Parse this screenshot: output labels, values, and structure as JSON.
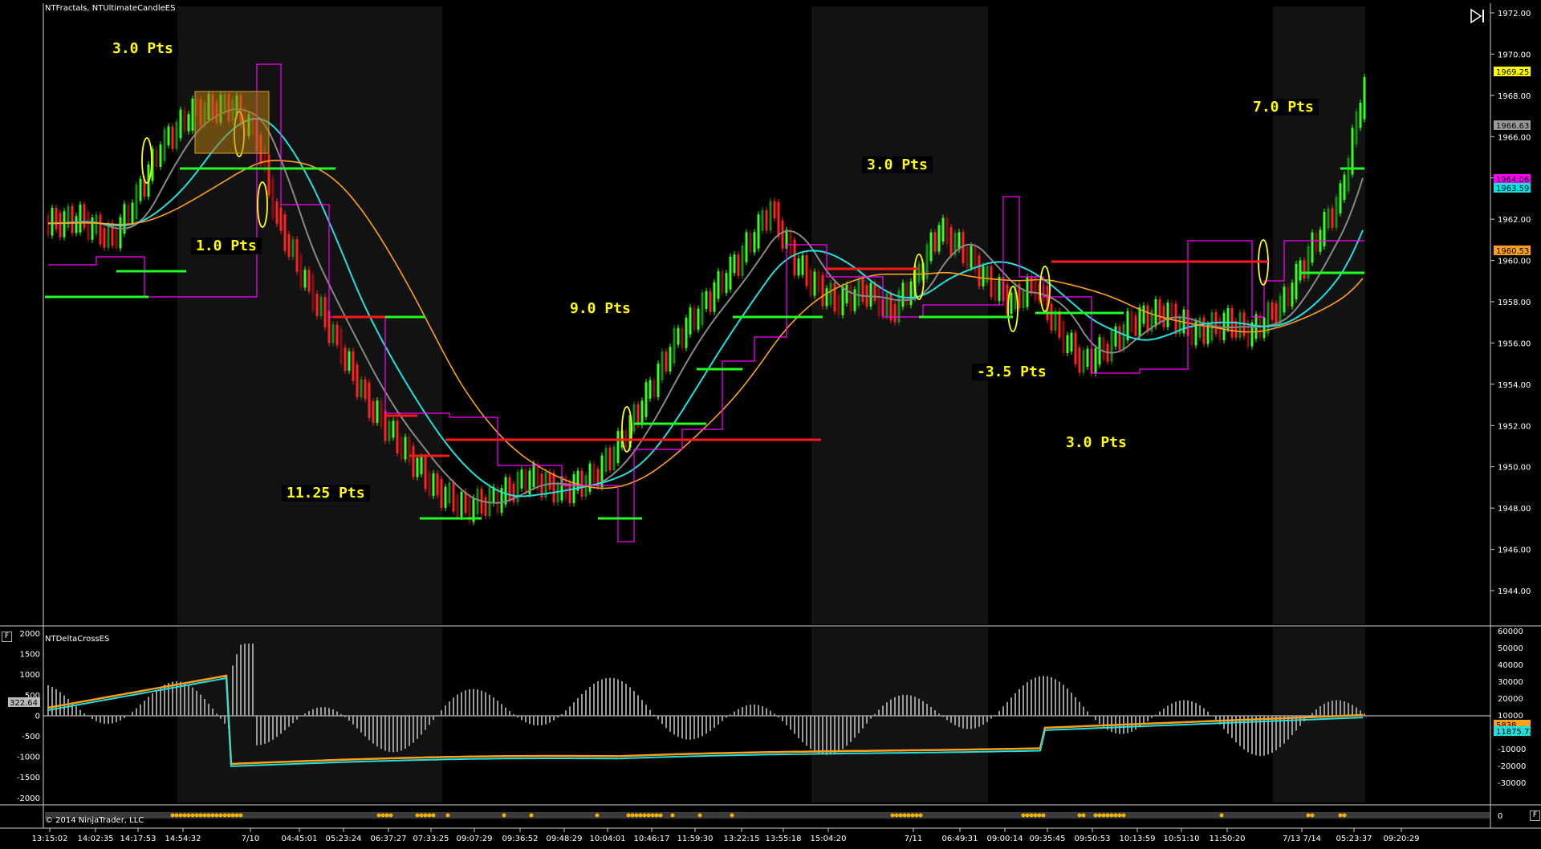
{
  "main_panel": {
    "title": "NTFractals, NTUltimateCandleES",
    "price_ticks": [
      "1972.00",
      "1970.00",
      "1968.00",
      "1966.00",
      "1964.00",
      "1962.00",
      "1960.00",
      "1958.00",
      "1956.00",
      "1954.00",
      "1952.00",
      "1950.00",
      "1948.00",
      "1946.00",
      "1944.00"
    ],
    "price_badges": [
      {
        "value": "1969.25",
        "color": "#ffff00"
      },
      {
        "value": "1966.63",
        "color": "#9a9a9a"
      },
      {
        "value": "1964.06",
        "color": "#ff00ff"
      },
      {
        "value": "1963.59",
        "color": "#00e5e5"
      },
      {
        "value": "1960.53",
        "color": "#ff9f1a"
      }
    ],
    "annotations": [
      "3.0 Pts",
      "1.0 Pts",
      "11.25 Pts",
      "9.0 Pts",
      "3.0 Pts",
      "-3.5 Pts",
      "3.0 Pts",
      "7.0 Pts"
    ]
  },
  "lower_panel": {
    "title": "NTDeltaCrossES",
    "left_ticks": [
      "2000",
      "1500",
      "1000",
      "500",
      "0",
      "-500",
      "-1000",
      "-1500",
      "-2000"
    ],
    "right_ticks": [
      "60000",
      "50000",
      "40000",
      "30000",
      "20000",
      "10000",
      "0",
      "-10000",
      "-20000",
      "-30000"
    ],
    "left_badge": "322.64",
    "right_badges": [
      "5838",
      "11875.72"
    ],
    "collapse_label": "F"
  },
  "bottom_strip": {
    "right_tick": "0",
    "copyright": "© 2014 NinjaTrader, LLC"
  },
  "time_axis": [
    "13:15:02",
    "14:02:35",
    "14:17:53",
    "14:54:32",
    "7/10",
    "04:45:01",
    "05:23:24",
    "06:37:27",
    "07:33:25",
    "09:07:29",
    "09:36:52",
    "09:48:29",
    "10:04:01",
    "10:46:17",
    "11:59:30",
    "13:22:15",
    "13:55:18",
    "15:04:20",
    "7/11",
    "06:49:31",
    "09:00:14",
    "09:35:45",
    "09:50:53",
    "10:13:59",
    "10:51:10",
    "11:50:20",
    "7/13 7/14",
    "05:23:37",
    "09:20:29"
  ],
  "icons": {
    "play_end": "skip-to-end-icon"
  }
}
